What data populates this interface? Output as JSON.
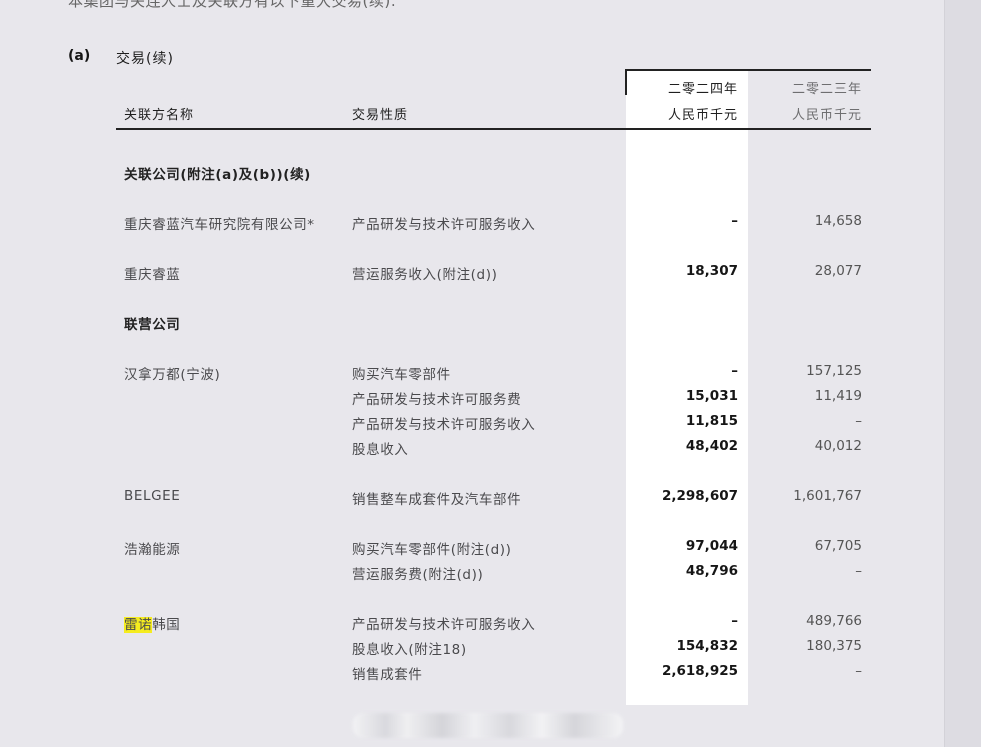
{
  "intro_line": "本集团与关连人士及关联方有以下重大交易(续):",
  "section": {
    "id": "(a)",
    "title": "交易(续)"
  },
  "columns": {
    "party": "关联方名称",
    "nature": "交易性质",
    "current_year": "二零二四年",
    "current_unit": "人民币千元",
    "previous_year": "二零二三年",
    "previous_unit": "人民币千元"
  },
  "groups": [
    {
      "heading": "关联公司(附注(a)及(b))(续)",
      "rows": [
        {
          "party": "重庆睿蓝汽车研究院有限公司*",
          "nature": "产品研发与技术许可服务收入",
          "y2024": "–",
          "y2023": "14,658"
        },
        {
          "party": "重庆睿蓝",
          "nature": "营运服务收入(附注(d))",
          "y2024": "18,307",
          "y2023": "28,077"
        }
      ]
    },
    {
      "heading": "联营公司",
      "rows": [
        {
          "party": "汉拿万都(宁波)",
          "nature": "购买汽车零部件",
          "y2024": "–",
          "y2023": "157,125"
        },
        {
          "party": "",
          "nature": "产品研发与技术许可服务费",
          "y2024": "15,031",
          "y2023": "11,419"
        },
        {
          "party": "",
          "nature": "产品研发与技术许可服务收入",
          "y2024": "11,815",
          "y2023": "–"
        },
        {
          "party": "",
          "nature": "股息收入",
          "y2024": "48,402",
          "y2023": "40,012"
        },
        {
          "party": "BELGEE",
          "nature": "销售整车成套件及汽车部件",
          "y2024": "2,298,607",
          "y2023": "1,601,767"
        },
        {
          "party": "浩瀚能源",
          "nature": "购买汽车零部件(附注(d))",
          "y2024": "97,044",
          "y2023": "67,705"
        },
        {
          "party": "",
          "nature": "营运服务费(附注(d))",
          "y2024": "48,796",
          "y2023": "–"
        },
        {
          "party_highlight": "雷诺",
          "party_rest": "韩国",
          "nature": "产品研发与技术许可服务收入",
          "y2024": "–",
          "y2023": "489,766"
        },
        {
          "party": "",
          "nature": "股息收入(附注18)",
          "y2024": "154,832",
          "y2023": "180,375"
        },
        {
          "party": "",
          "nature": "销售成套件",
          "y2024": "2,618,925",
          "y2023": "–"
        }
      ]
    }
  ],
  "colors": {
    "highlight": "#f5ec1f",
    "page_background": "#e8e7ec",
    "current_column_background": "#ffffff"
  }
}
